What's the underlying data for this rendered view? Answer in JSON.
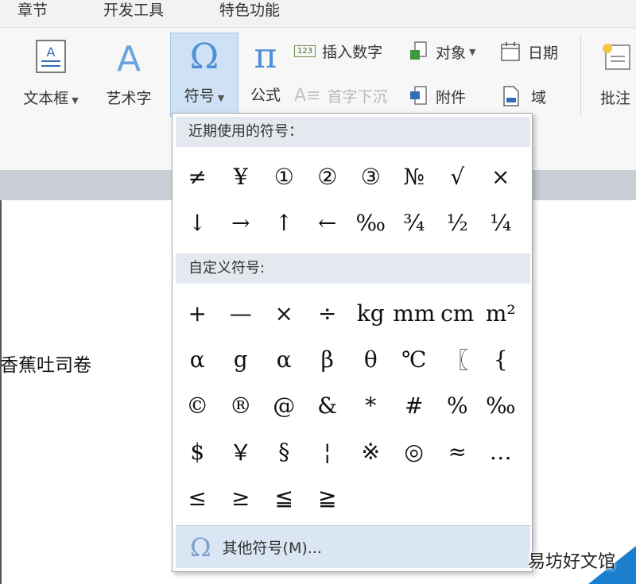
{
  "tabs": [
    "章节",
    "开发工具",
    "特色功能"
  ],
  "ribbon": {
    "textbox": "文本框",
    "wordart": "艺术字",
    "symbol": "符号",
    "formula": "公式",
    "insert_number": "插入数字",
    "number_icon_text": "123",
    "drop_cap": "首字下沉",
    "object": "对象",
    "attachment": "附件",
    "date": "日期",
    "field": "域",
    "comment": "批注"
  },
  "panel": {
    "recent_header": "近期使用的符号：",
    "recent": [
      "≠",
      "¥",
      "①",
      "②",
      "③",
      "№",
      "√",
      "×",
      "↓",
      "→",
      "↑",
      "←",
      "‰",
      "¾",
      "½",
      "¼"
    ],
    "custom_header": "自定义符号:",
    "custom": [
      "+",
      "—",
      "×",
      "÷",
      "kg",
      "mm",
      "cm",
      "m²",
      "α",
      "g",
      "α",
      "β",
      "θ",
      "℃",
      "〖",
      "{",
      "©",
      "®",
      "@",
      "&",
      "*",
      "#",
      "%",
      "‰",
      "$",
      "￥",
      "§",
      "¦",
      "※",
      "◎",
      "≈",
      "…",
      "≤",
      "≥",
      "≦",
      "≧"
    ],
    "more_label": "其他符号(M)..."
  },
  "document": {
    "text": "香蕉吐司卷"
  },
  "watermark": "易坊好文馆"
}
